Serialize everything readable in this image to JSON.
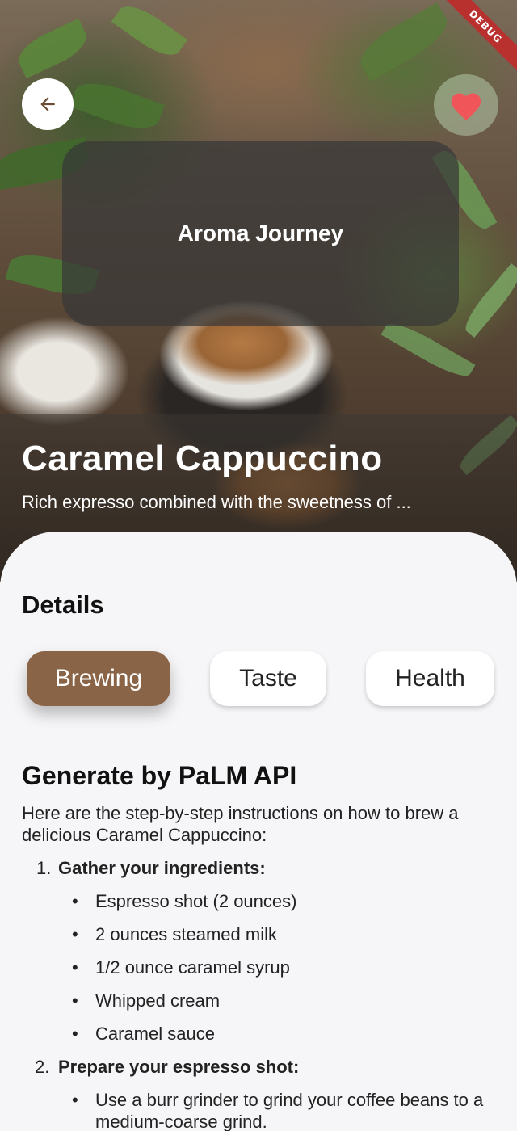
{
  "debug_banner": "DEBUG",
  "header": {
    "back_icon": "arrow-left-icon",
    "favorite_icon": "heart-icon",
    "favorite_color": "#f0555a"
  },
  "aroma_card": {
    "title": "Aroma Journey"
  },
  "coffee": {
    "name": "Caramel Cappuccino",
    "description": "Rich expresso combined with the sweetness of ..."
  },
  "details": {
    "title": "Details",
    "tabs": [
      {
        "label": "Brewing",
        "active": true
      },
      {
        "label": "Taste",
        "active": false
      },
      {
        "label": "Health",
        "active": false
      }
    ],
    "active_color": "#8a6447"
  },
  "generated": {
    "title": "Generate by PaLM API",
    "intro": "Here are the step-by-step instructions on how to brew a delicious Caramel Cappuccino:",
    "steps": [
      {
        "num": "1.",
        "title": "Gather your ingredients:",
        "bullets": [
          "Espresso shot (2 ounces)",
          "2 ounces steamed milk",
          "1/2 ounce caramel syrup",
          "Whipped cream",
          "Caramel sauce"
        ]
      },
      {
        "num": "2.",
        "title": "Prepare your espresso shot:",
        "bullets": [
          "Use a burr grinder to grind your coffee beans to a medium-coarse grind."
        ]
      }
    ]
  }
}
